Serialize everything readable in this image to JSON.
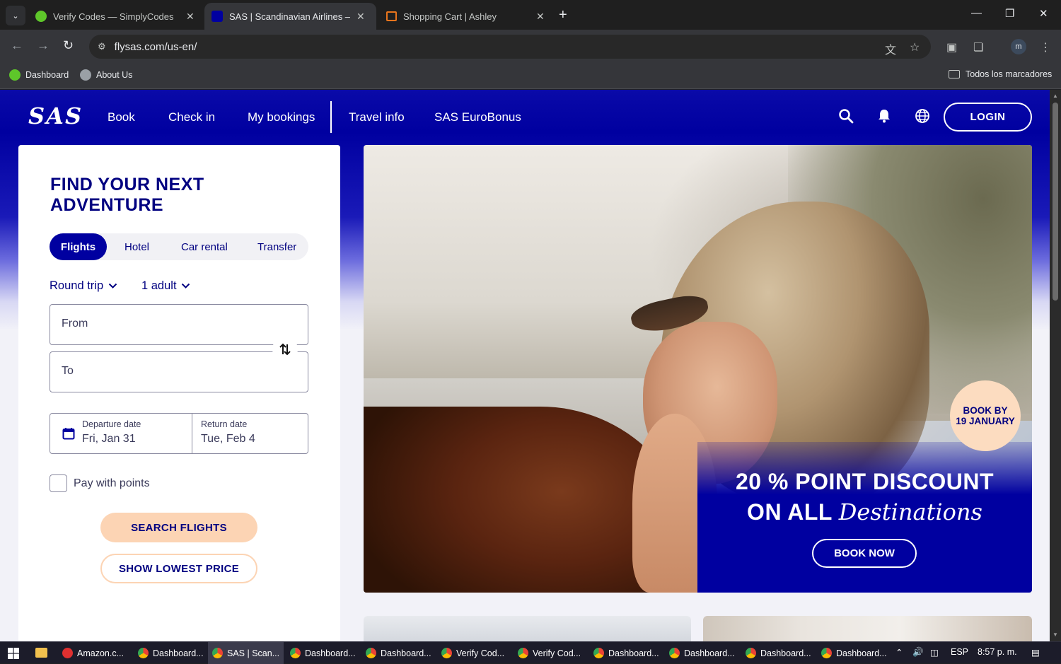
{
  "browser": {
    "tabs": [
      {
        "title": "Verify Codes — SimplyCodes",
        "icon": "simplycodes-icon",
        "active": false
      },
      {
        "title": "SAS | Scandinavian Airlines – Book",
        "icon": "sas-icon",
        "active": true
      },
      {
        "title": "Shopping Cart | Ashley",
        "icon": "ashley-icon",
        "active": false
      }
    ],
    "new_tab": "+",
    "url": "flysas.com/us-en/",
    "profile_initial": "m",
    "bookmarks": [
      {
        "label": "Dashboard",
        "icon": "simplycodes-icon"
      },
      {
        "label": "About Us",
        "icon": "globe-icon"
      }
    ],
    "all_bookmarks": "Todos los marcadores"
  },
  "site": {
    "logo": "SAS",
    "nav": [
      "Book",
      "Check in",
      "My bookings",
      "Travel info",
      "SAS EuroBonus"
    ],
    "login": "LOGIN"
  },
  "search": {
    "heading_1": "FIND YOUR NEXT",
    "heading_2": "ADVENTURE",
    "tabs": [
      "Flights",
      "Hotel",
      "Car rental",
      "Transfer"
    ],
    "trip_type": "Round trip",
    "passengers": "1 adult",
    "from_placeholder": "From",
    "to_placeholder": "To",
    "departure_label": "Departure date",
    "departure_value": "Fri, Jan 31",
    "return_label": "Return date",
    "return_value": "Tue, Feb 4",
    "pay_with_points": "Pay with points",
    "search_button": "SEARCH FLIGHTS",
    "lowest_button": "SHOW LOWEST PRICE"
  },
  "hero": {
    "badge_1": "BOOK BY",
    "badge_2": "19 JANUARY",
    "line_1": "20 % POINT DISCOUNT",
    "line_2_bold": "ON ALL",
    "line_2_italic": "Destinations",
    "cta": "BOOK NOW"
  },
  "taskbar": {
    "items": [
      "Amazon.c...",
      "Dashboard...",
      "SAS | Scan...",
      "Dashboard...",
      "Dashboard...",
      "Verify Cod...",
      "Verify Cod...",
      "Dashboard...",
      "Dashboard...",
      "Dashboard...",
      "Dashboard..."
    ],
    "language": "ESP",
    "time": "8:57 p. m."
  },
  "colors": {
    "sas_blue": "#0000a0",
    "navy_text": "#000080",
    "peach": "#fcd4b4"
  }
}
